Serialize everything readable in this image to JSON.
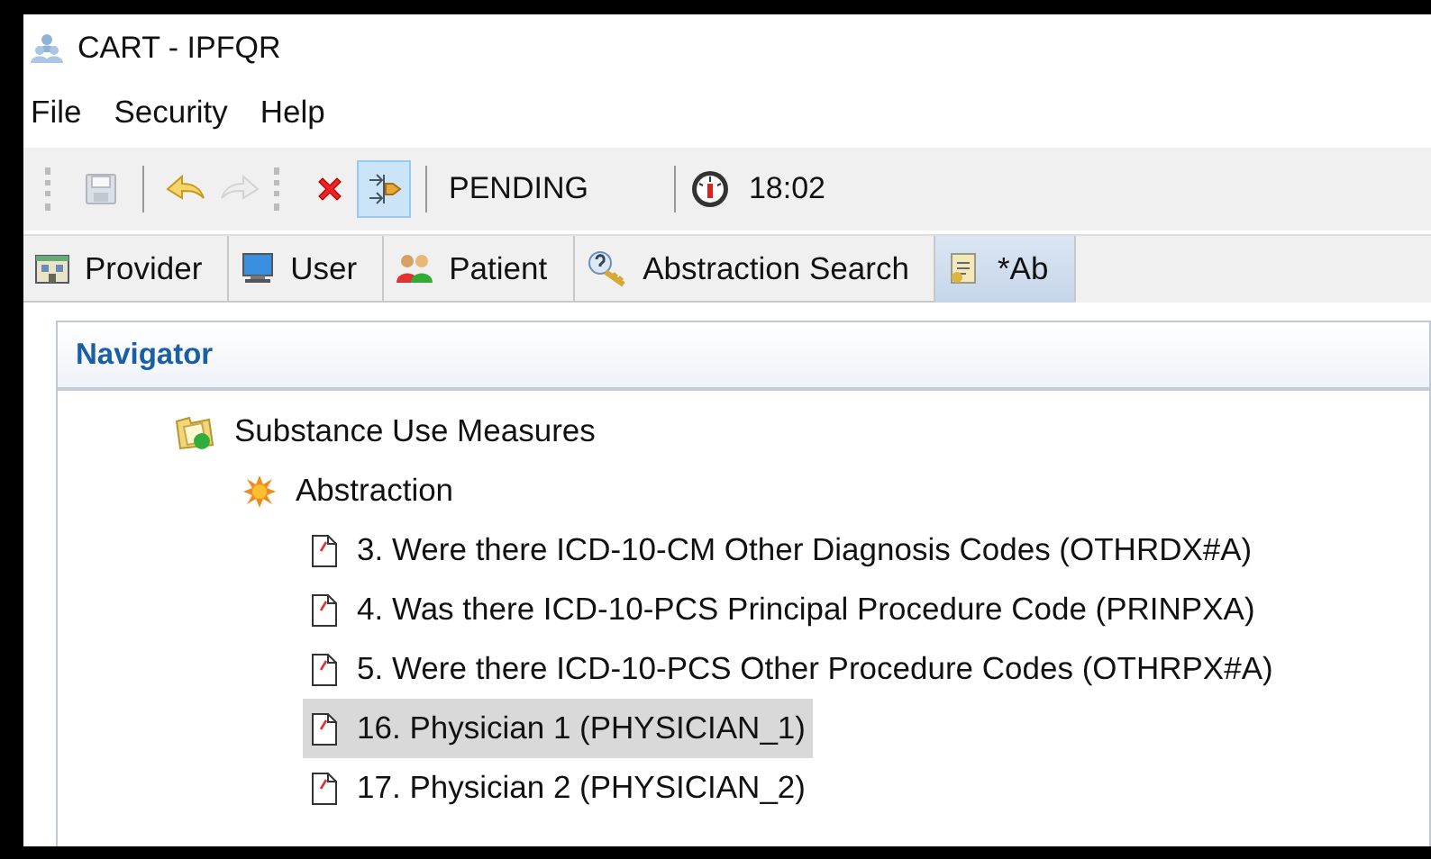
{
  "window": {
    "title": "CART - IPFQR"
  },
  "menu": [
    {
      "label": "File"
    },
    {
      "label": "Security"
    },
    {
      "label": "Help"
    }
  ],
  "toolbar": {
    "buttons": [
      {
        "kind": "save",
        "disabled": true,
        "pressed": false
      },
      {
        "kind": "undo",
        "disabled": false,
        "pressed": false
      },
      {
        "kind": "redo",
        "disabled": true,
        "pressed": false
      },
      {
        "kind": "delete",
        "disabled": false,
        "pressed": false
      },
      {
        "kind": "move",
        "disabled": false,
        "pressed": true
      }
    ],
    "status": "PENDING",
    "time": "18:02"
  },
  "tabs": [
    {
      "label": "Provider",
      "kind": "provider",
      "selected": false
    },
    {
      "label": "User",
      "kind": "user",
      "selected": false
    },
    {
      "label": "Patient",
      "kind": "patient",
      "selected": false
    },
    {
      "label": "Abstraction Search",
      "kind": "search",
      "selected": false
    },
    {
      "label": "*Ab",
      "kind": "abstraction",
      "selected": true
    }
  ],
  "navigator": {
    "title": "Navigator",
    "tree": [
      {
        "label": "Substance Use Measures",
        "kind": "folder",
        "selected": false,
        "children": [
          {
            "label": "Abstraction",
            "kind": "abstraction",
            "selected": false,
            "children": [
              {
                "label": "3. Were there ICD-10-CM Other Diagnosis Codes (OTHRDX#A)",
                "kind": "document",
                "selected": false
              },
              {
                "label": "4. Was there ICD-10-PCS Principal Procedure Code (PRINPXA)",
                "kind": "document",
                "selected": false
              },
              {
                "label": "5. Were there ICD-10-PCS Other Procedure Codes (OTHRPX#A)",
                "kind": "document",
                "selected": false
              },
              {
                "label": "16. Physician 1 (PHYSICIAN_1)",
                "kind": "document",
                "selected": true
              },
              {
                "label": "17. Physician 2 (PHYSICIAN_2)",
                "kind": "document",
                "selected": false
              }
            ]
          }
        ]
      }
    ]
  }
}
